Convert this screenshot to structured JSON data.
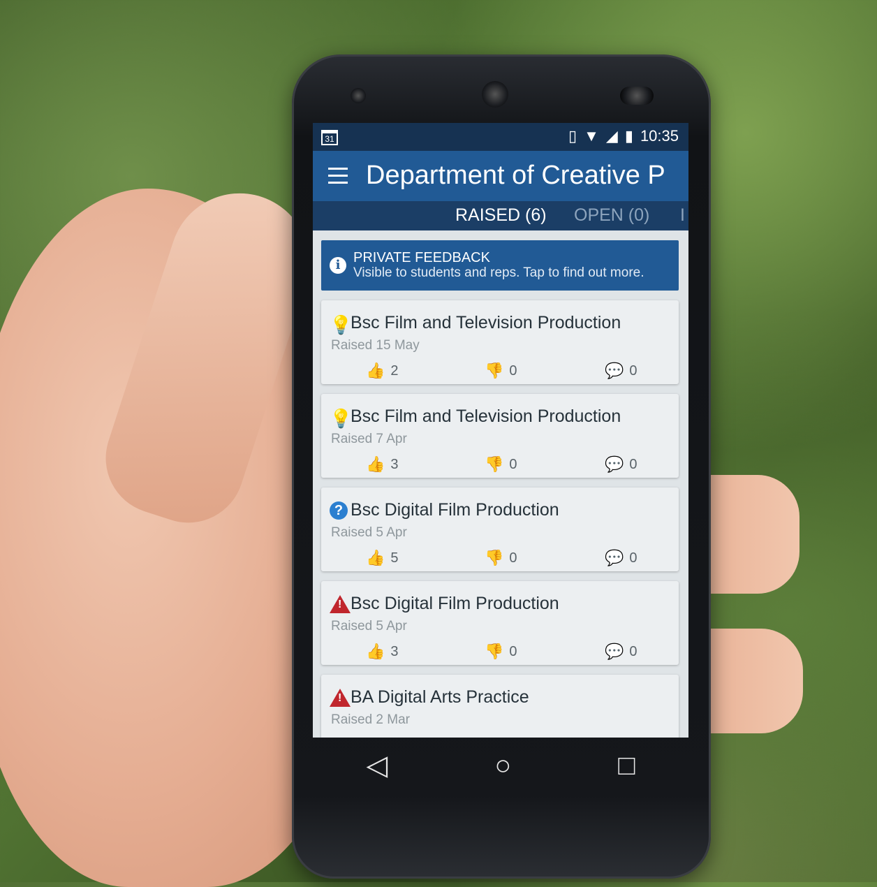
{
  "status_bar": {
    "calendar_day": "31",
    "time": "10:35"
  },
  "app_bar": {
    "title": "Department of Creative P"
  },
  "tabs": [
    {
      "label": "RAISED (6)"
    },
    {
      "label": "OPEN (0)"
    },
    {
      "label": "I"
    }
  ],
  "banner": {
    "title": "PRIVATE FEEDBACK",
    "subtitle": "Visible to students and reps. Tap to find out more."
  },
  "cards": [
    {
      "title": "Bsc Film and Television Production",
      "date": "Raised 15 May",
      "likes": "2",
      "dislikes": "0",
      "comments": "0",
      "icon": "lightbulb-icon"
    },
    {
      "title": "Bsc Film and Television Production",
      "date": "Raised 7 Apr",
      "likes": "3",
      "dislikes": "0",
      "comments": "0",
      "icon": "lightbulb-icon"
    },
    {
      "title": "Bsc Digital Film Production",
      "date": "Raised 5 Apr",
      "likes": "5",
      "dislikes": "0",
      "comments": "0",
      "icon": "question-icon"
    },
    {
      "title": "Bsc Digital Film Production",
      "date": "Raised 5 Apr",
      "likes": "3",
      "dislikes": "0",
      "comments": "0",
      "icon": "warning-icon"
    },
    {
      "title": "BA Digital Arts Practice",
      "date": "Raised 2 Mar",
      "likes": "",
      "dislikes": "",
      "comments": "",
      "icon": "warning-icon"
    }
  ],
  "colors": {
    "primary": "#215a95",
    "status_bar": "#163252",
    "tab_bar": "#1b3e66",
    "warning": "#c0262d",
    "idea": "#e8962a",
    "question": "#2b7fd0"
  }
}
